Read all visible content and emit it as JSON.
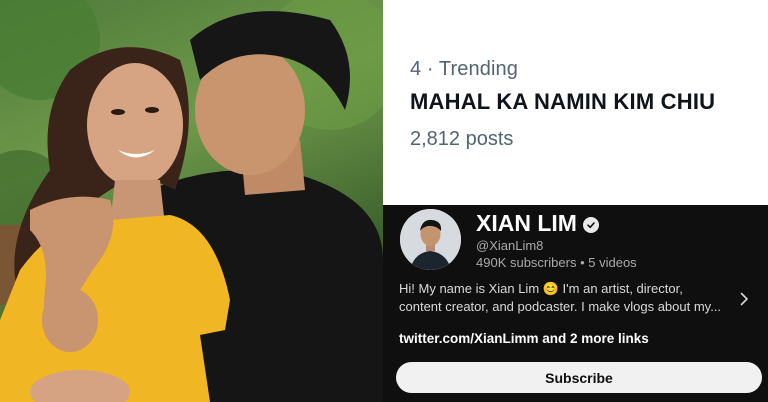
{
  "trending": {
    "meta": "4 · Trending",
    "title": "MAHAL KA NAMIN KIM CHIU",
    "posts": "2,812 posts"
  },
  "channel": {
    "name": "XIAN LIM",
    "handle": "@XianLim8",
    "subscribers": "490K subscribers",
    "separator": "•",
    "videos": "5 videos",
    "description": "Hi! My name is Xian Lim 😊 I'm an artist, director, content creator, and podcaster. I make vlogs about my...",
    "links": "twitter.com/XianLimm and 2 more links",
    "subscribe_label": "Subscribe"
  },
  "icons": {
    "verified": "verified-check-icon",
    "chevron": "chevron-right-icon"
  },
  "colors": {
    "trend_muted": "#536471",
    "channel_bg": "#0f0f0f",
    "subscribe_bg": "#f1f1f1"
  }
}
